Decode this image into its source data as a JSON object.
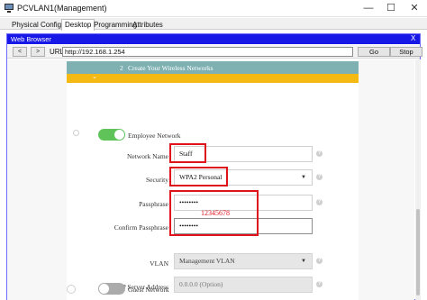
{
  "window": {
    "title": "PCVLAN1(Management)",
    "minimize": "—",
    "maximize": "☐",
    "close": "✕"
  },
  "tabs": [
    {
      "label": "Physical"
    },
    {
      "label": "Config"
    },
    {
      "label": "Desktop"
    },
    {
      "label": "Programming"
    },
    {
      "label": "Attributes"
    }
  ],
  "browser": {
    "title": "Web Browser",
    "close": "X",
    "back": "<",
    "forward": ">",
    "url_label": "URL",
    "url": "http://192.168.1.254",
    "go": "Go",
    "stop": "Stop"
  },
  "wizard": {
    "step_number": "2",
    "step_title": "Create Your Wireless Networks",
    "collapse_chevron": "⌄"
  },
  "employee_network": {
    "toggle_label": "Employee Network",
    "enabled": true,
    "network_name_label": "Network Name",
    "network_name": "Staff",
    "security_label": "Security",
    "security": "WPA2 Personal",
    "passphrase_label": "Passphrase",
    "passphrase": "••••••••",
    "confirm_label": "Confirm Passphrase",
    "confirm": "••••••••",
    "annotation": "12345678",
    "vlan_label": "VLAN",
    "vlan": "Management VLAN",
    "dhcp_label": "DHCP Server Address",
    "dhcp_placeholder": "0.0.0.0 (Option)"
  },
  "guest_network": {
    "toggle_label": "Guest Network",
    "enabled": false
  },
  "help_glyph": "?",
  "caret_glyph": "▼",
  "colors": {
    "browser_title_bar": "#1717e6",
    "step_band": "#7fb1b3",
    "accent_bar": "#f4b913",
    "toggle_on": "#5fc35a",
    "toggle_off": "#ababab",
    "highlight": "#e1131a"
  }
}
